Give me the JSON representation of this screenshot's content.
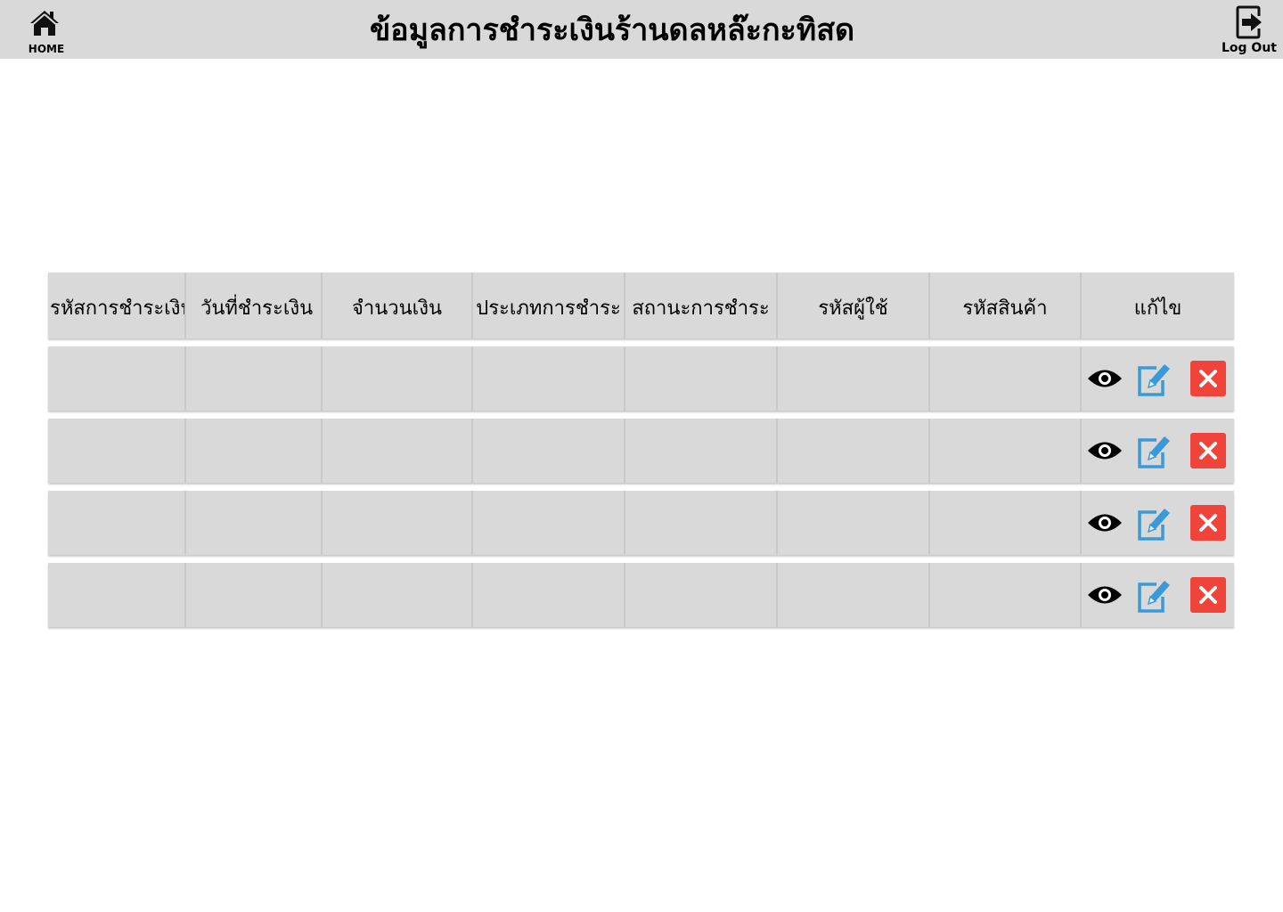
{
  "header": {
    "home_label": "HOME",
    "title": "ข้อมูลการชำระเงินร้านดลหล๊ะกะทิสด",
    "logout_label": "Log Out"
  },
  "table": {
    "columns": [
      "รหัสการชำระเงิน",
      "วันที่ชำระเงิน",
      "จำนวนเงิน",
      "ประเภทการชำระ",
      "สถานะการชำระ",
      "รหัสผู้ใช้",
      "รหัสสินค้า",
      "แก้ไข"
    ],
    "rows": [
      {
        "cells": [
          "",
          "",
          "",
          "",
          "",
          "",
          ""
        ]
      },
      {
        "cells": [
          "",
          "",
          "",
          "",
          "",
          "",
          ""
        ]
      },
      {
        "cells": [
          "",
          "",
          "",
          "",
          "",
          "",
          ""
        ]
      },
      {
        "cells": [
          "",
          "",
          "",
          "",
          "",
          "",
          ""
        ]
      }
    ],
    "row_actions": [
      "eye-icon",
      "edit-icon",
      "delete-icon"
    ]
  },
  "colors": {
    "bar": "#d9d9d9",
    "edit_blue": "#3a9ad9",
    "delete_red": "#f0433a"
  }
}
